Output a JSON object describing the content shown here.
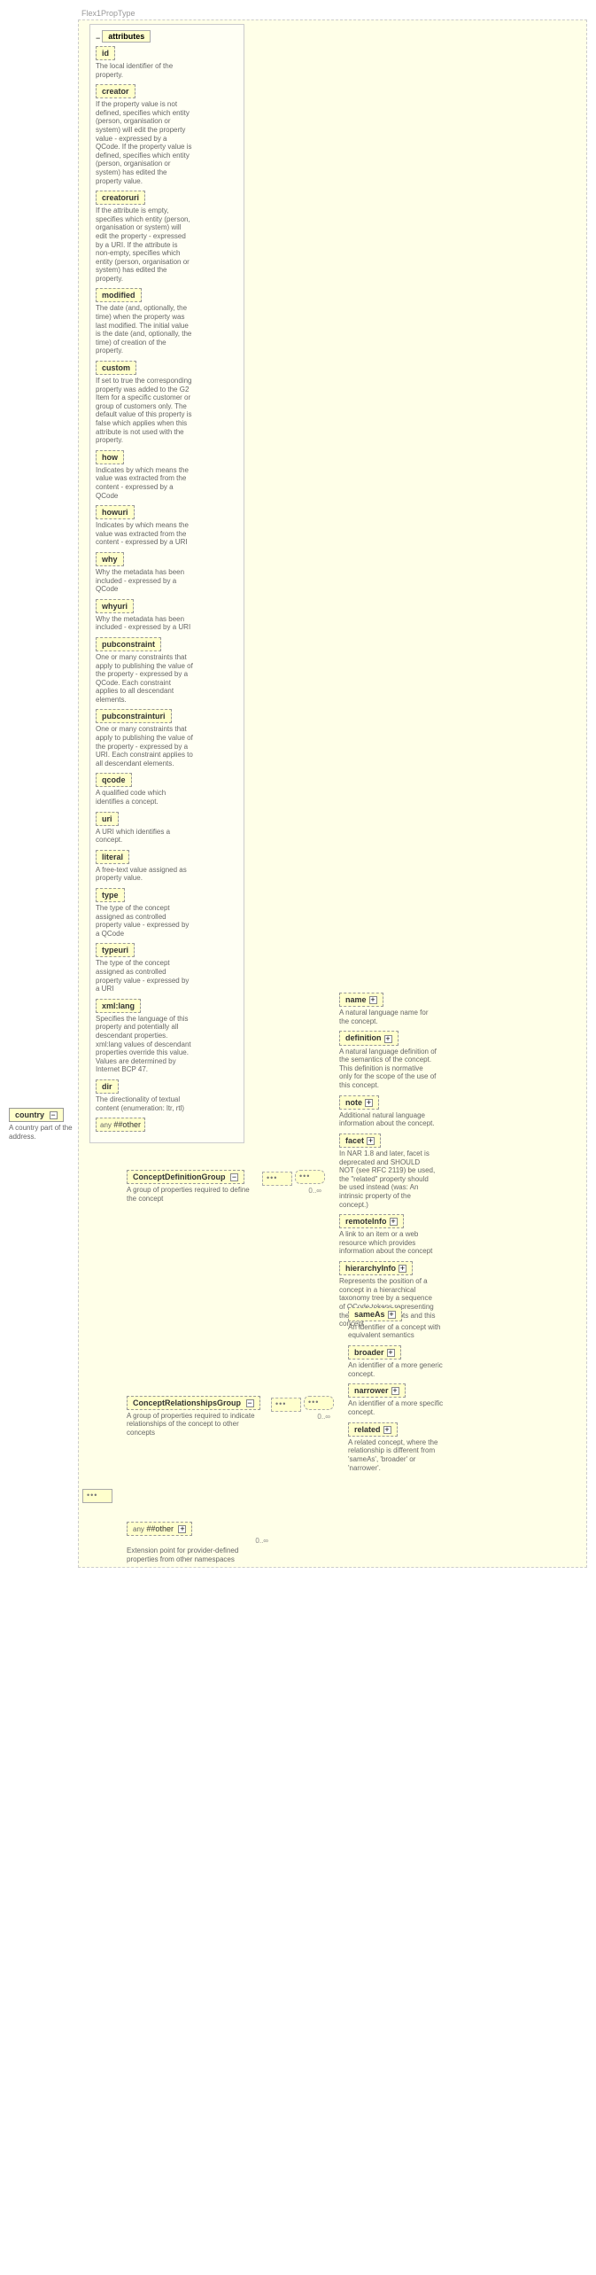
{
  "rootType": "Flex1PropType",
  "root": {
    "name": "country",
    "doc": "A country part of the address."
  },
  "attributesHeader": "attributes",
  "attributes": [
    {
      "name": "id",
      "doc": "The local identifier of the property."
    },
    {
      "name": "creator",
      "doc": "If the property value is not defined, specifies which entity (person, organisation or system) will edit the property value - expressed by a QCode. If the property value is defined, specifies which entity (person, organisation or system) has edited the property value."
    },
    {
      "name": "creatoruri",
      "doc": "If the attribute is empty, specifies which entity (person, organisation or system) will edit the property - expressed by a URI. If the attribute is non-empty, specifies which entity (person, organisation or system) has edited the property."
    },
    {
      "name": "modified",
      "doc": "The date (and, optionally, the time) when the property was last modified. The initial value is the date (and, optionally, the time) of creation of the property."
    },
    {
      "name": "custom",
      "doc": "If set to true the corresponding property was added to the G2 Item for a specific customer or group of customers only. The default value of this property is false which applies when this attribute is not used with the property."
    },
    {
      "name": "how",
      "doc": "Indicates by which means the value was extracted from the content - expressed by a QCode"
    },
    {
      "name": "howuri",
      "doc": "Indicates by which means the value was extracted from the content - expressed by a URI"
    },
    {
      "name": "why",
      "doc": "Why the metadata has been included - expressed by a QCode"
    },
    {
      "name": "whyuri",
      "doc": "Why the metadata has been included - expressed by a URI"
    },
    {
      "name": "pubconstraint",
      "doc": "One or many constraints that apply to publishing the value of the property - expressed by a QCode. Each constraint applies to all descendant elements."
    },
    {
      "name": "pubconstrainturi",
      "doc": "One or many constraints that apply to publishing the value of the property - expressed by a URI. Each constraint applies to all descendant elements."
    },
    {
      "name": "qcode",
      "doc": "A qualified code which identifies a concept."
    },
    {
      "name": "uri",
      "doc": "A URI which identifies a concept."
    },
    {
      "name": "literal",
      "doc": "A free-text value assigned as property value."
    },
    {
      "name": "type",
      "doc": "The type of the concept assigned as controlled property value - expressed by a QCode"
    },
    {
      "name": "typeuri",
      "doc": "The type of the concept assigned as controlled property value - expressed by a URI"
    },
    {
      "name": "xml:lang",
      "doc": "Specifies the language of this property and potentially all descendant properties. xml:lang values of descendant properties override this value. Values are determined by Internet BCP 47."
    },
    {
      "name": "dir",
      "doc": "The directionality of textual content (enumeration: ltr, rtl)"
    }
  ],
  "anyOther": "##other",
  "anyLabel": "any",
  "groups": {
    "conceptDef": {
      "name": "ConceptDefinitionGroup",
      "doc": "A group of properties required to define the concept",
      "card": "0..∞"
    },
    "conceptRel": {
      "name": "ConceptRelationshipsGroup",
      "doc": "A group of properties required to indicate relationships of the concept to other concepts",
      "card": "0..∞"
    }
  },
  "defChildren": [
    {
      "name": "name",
      "doc": "A natural language name for the concept."
    },
    {
      "name": "definition",
      "doc": "A natural language definition of the semantics of the concept. This definition is normative only for the scope of the use of this concept."
    },
    {
      "name": "note",
      "doc": "Additional natural language information about the concept."
    },
    {
      "name": "facet",
      "doc": "In NAR 1.8 and later, facet is deprecated and SHOULD NOT (see RFC 2119) be used, the \"related\" property should be used instead (was: An intrinsic property of the concept.)"
    },
    {
      "name": "remoteInfo",
      "doc": "A link to an item or a web resource which provides information about the concept"
    },
    {
      "name": "hierarchyInfo",
      "doc": "Represents the position of a concept in a hierarchical taxonomy tree by a sequence of QCode tokens representing the ancestor concepts and this concept"
    }
  ],
  "relChildren": [
    {
      "name": "sameAs",
      "doc": "An identifier of a concept with equivalent semantics"
    },
    {
      "name": "broader",
      "doc": "An identifier of a more generic concept."
    },
    {
      "name": "narrower",
      "doc": "An identifier of a more specific concept."
    },
    {
      "name": "related",
      "doc": "A related concept, where the relationship is different from 'sameAs', 'broader' or 'narrower'."
    }
  ],
  "extAny": {
    "label": "any ##other",
    "card": "0..∞",
    "doc": "Extension point for provider-defined properties from other namespaces"
  }
}
